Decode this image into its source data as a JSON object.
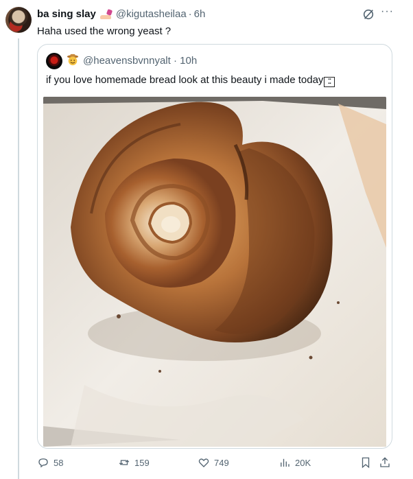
{
  "tweet": {
    "author_name": "ba sing slay",
    "author_handle": "@kigutasheilaa",
    "separator": "·",
    "time": "6h",
    "text": "Haha used the wrong yeast ?"
  },
  "quote": {
    "handle": "@heavensbvnnyalt",
    "separator": "·",
    "time": "10h",
    "text": "if you love homemade bread look at this beauty i made today",
    "trailing_glyph": "⬚"
  },
  "actions": {
    "replies": "58",
    "reposts": "159",
    "likes": "749",
    "views": "20K"
  },
  "icons": {
    "reply": "reply-icon",
    "repost": "repost-icon",
    "like": "heart-icon",
    "views": "views-icon",
    "bookmark": "bookmark-icon",
    "share": "share-icon",
    "grok": "grok-icon",
    "more": "more-icon"
  },
  "colors": {
    "text": "#0f1419",
    "muted": "#536471",
    "border": "#cfd9de"
  }
}
